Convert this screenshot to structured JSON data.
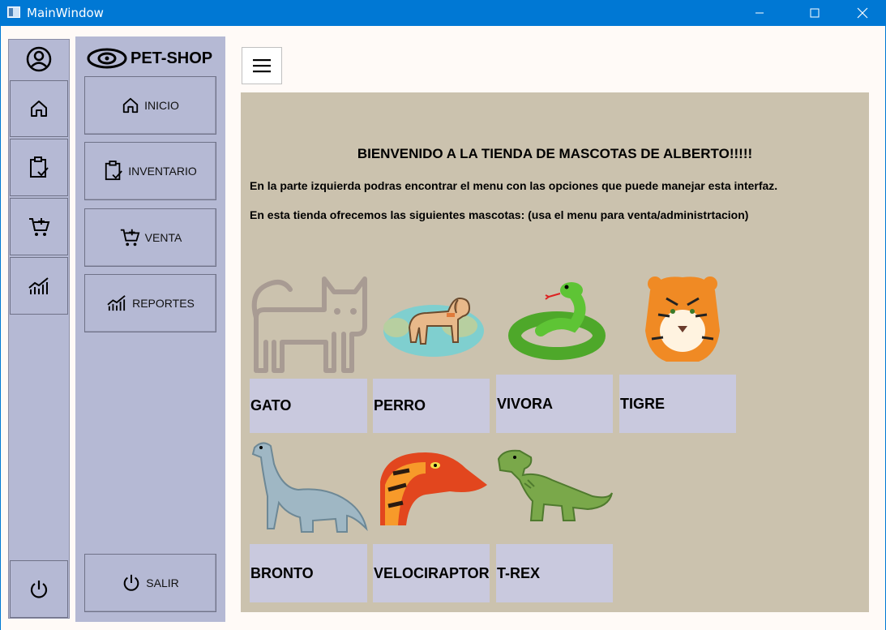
{
  "window": {
    "title": "MainWindow"
  },
  "brand": {
    "name": "PET-SHOP"
  },
  "menu": {
    "items": [
      {
        "label": "INICIO",
        "icon": "home-icon"
      },
      {
        "label": "INVENTARIO",
        "icon": "clipboard-check-icon"
      },
      {
        "label": "VENTA",
        "icon": "cart-add-icon"
      },
      {
        "label": "REPORTES",
        "icon": "chart-icon"
      }
    ],
    "exit_label": "SALIR"
  },
  "content": {
    "welcome": "BIENVENIDO A LA TIENDA DE MASCOTAS DE ALBERTO!!!!!",
    "line1": "En la parte izquierda podras encontrar el menu con las opciones que puede manejar esta interfaz.",
    "line2": "En esta tienda ofrecemos las siguientes mascotas: (usa el menu para venta/administrtacion)",
    "pets": [
      "GATO",
      "PERRO",
      "VIVORA",
      "TIGRE",
      "BRONTO",
      "VELOCIRAPTOR",
      "T-REX"
    ]
  },
  "colors": {
    "titlebar": "#0078d4",
    "sidebar": "#b5b9d4",
    "content_bg": "#cbc2ae",
    "label_bg": "#c9c9de"
  }
}
